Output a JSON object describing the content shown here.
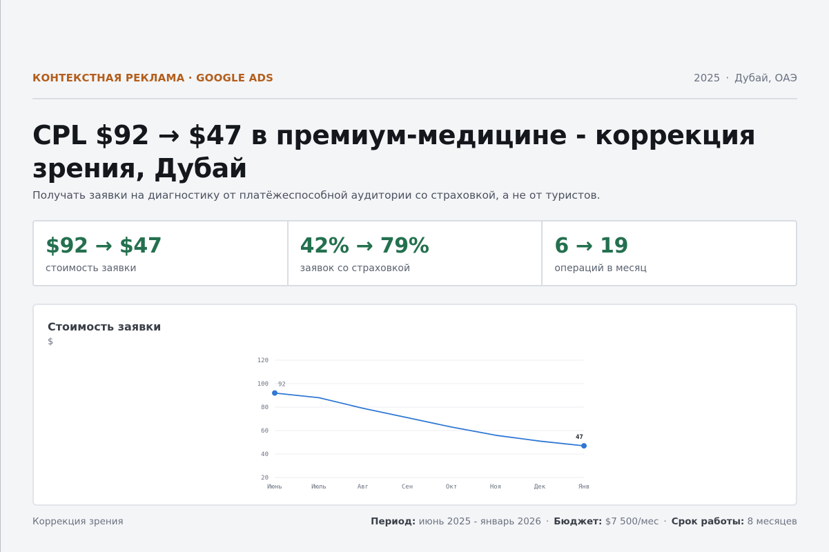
{
  "header": {
    "tag": "КОНТЕКСТНАЯ РЕКЛАМА · GOOGLE ADS",
    "year": "2025",
    "location": "Дубай, ОАЭ"
  },
  "title": "CPL $92 → $47 в премиум-медицине - коррекция зрения, Дубай",
  "subtitle": "Получать заявки на диагностику от платёжеспособной аудитории со страховкой, а не от туристов.",
  "stats": [
    {
      "value": "$92 → $47",
      "label": "стоимость заявки"
    },
    {
      "value": "42% → 79%",
      "label": "заявок со страховкой"
    },
    {
      "value": "6 → 19",
      "label": "операций в месяц"
    }
  ],
  "chart_card": {
    "title": "Стоимость заявки",
    "unit": "$"
  },
  "chart_data": {
    "type": "line",
    "title": "Стоимость заявки",
    "ylabel": "$",
    "categories": [
      "Июнь",
      "Июль",
      "Авг",
      "Сен",
      "Окт",
      "Ноя",
      "Дек",
      "Янв"
    ],
    "series": [
      {
        "values": [
          92,
          88,
          79,
          71,
          63,
          56,
          51,
          47
        ]
      }
    ],
    "ylim": [
      20,
      120
    ],
    "yticks": [
      20,
      40,
      60,
      80,
      100,
      120
    ],
    "point_labels": [
      {
        "index": 0,
        "text": "92"
      },
      {
        "index": 7,
        "text": "47"
      }
    ],
    "grid": true,
    "line_color": "#2f78d4"
  },
  "footer": {
    "left": "Коррекция зрения",
    "period_label": "Период:",
    "period_value": "июнь 2025 - январь 2026",
    "budget_label": "Бюджет:",
    "budget_value": "$7 500/мес",
    "term_label": "Срок работы:",
    "term_value": "8 месяцев"
  }
}
